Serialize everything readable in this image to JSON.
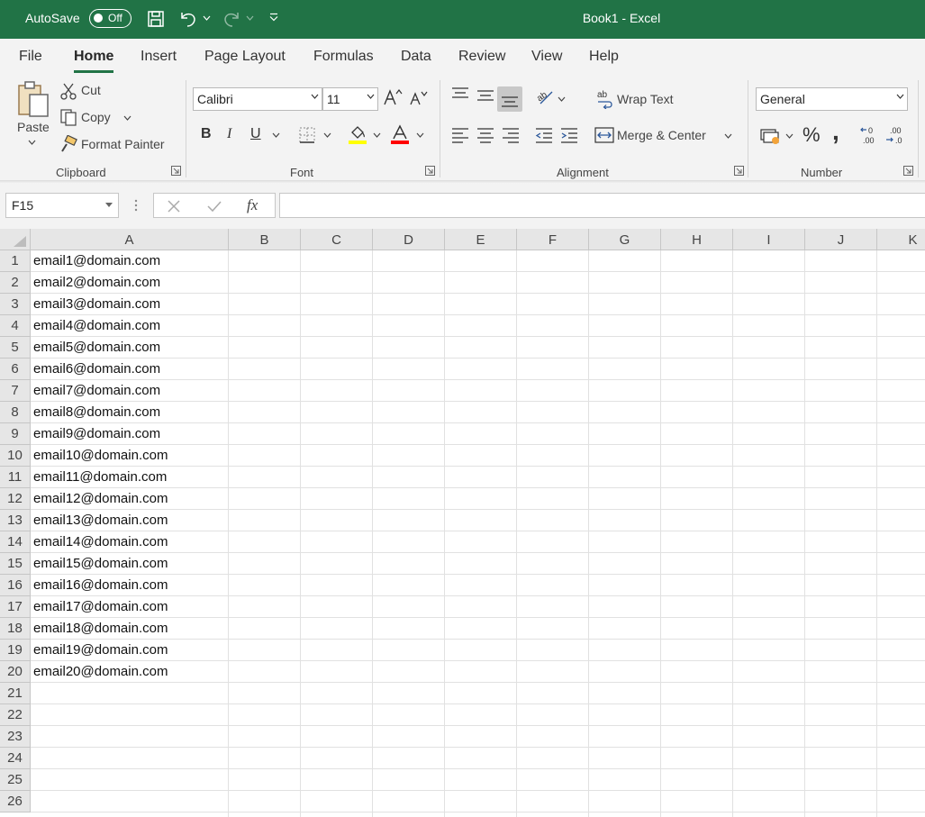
{
  "titlebar": {
    "autosave_label": "AutoSave",
    "autosave_state": "Off",
    "doc_title": "Book1  -  Excel",
    "accent_color": "#217346"
  },
  "tabs": [
    "File",
    "Home",
    "Insert",
    "Page Layout",
    "Formulas",
    "Data",
    "Review",
    "View",
    "Help"
  ],
  "active_tab": "Home",
  "clipboard": {
    "paste": "Paste",
    "cut": "Cut",
    "copy": "Copy",
    "format_painter": "Format Painter",
    "group_label": "Clipboard"
  },
  "font": {
    "family": "Calibri",
    "size": "11",
    "bold": "B",
    "italic": "I",
    "underline": "U",
    "fill_color": "#ffff00",
    "font_color": "#ff0000",
    "group_label": "Font"
  },
  "alignment": {
    "wrap_text": "Wrap Text",
    "merge_center": "Merge & Center",
    "group_label": "Alignment"
  },
  "number": {
    "format": "General",
    "percent": "%",
    "comma": ",",
    "group_label": "Number"
  },
  "formula_bar": {
    "name_box": "F15",
    "fx": "fx",
    "formula": ""
  },
  "columns": [
    "A",
    "B",
    "C",
    "D",
    "E",
    "F",
    "G",
    "H",
    "I",
    "J",
    "K"
  ],
  "rows": [
    "1",
    "2",
    "3",
    "4",
    "5",
    "6",
    "7",
    "8",
    "9",
    "10",
    "11",
    "12",
    "13",
    "14",
    "15",
    "16",
    "17",
    "18",
    "19",
    "20",
    "21",
    "22",
    "23",
    "24",
    "25",
    "26"
  ],
  "column_a": [
    "email1@domain.com",
    "email2@domain.com",
    "email3@domain.com",
    "email4@domain.com",
    "email5@domain.com",
    "email6@domain.com",
    "email7@domain.com",
    "email8@domain.com",
    "email9@domain.com",
    "email10@domain.com",
    "email11@domain.com",
    "email12@domain.com",
    "email13@domain.com",
    "email14@domain.com",
    "email15@domain.com",
    "email16@domain.com",
    "email17@domain.com",
    "email18@domain.com",
    "email19@domain.com",
    "email20@domain.com"
  ]
}
